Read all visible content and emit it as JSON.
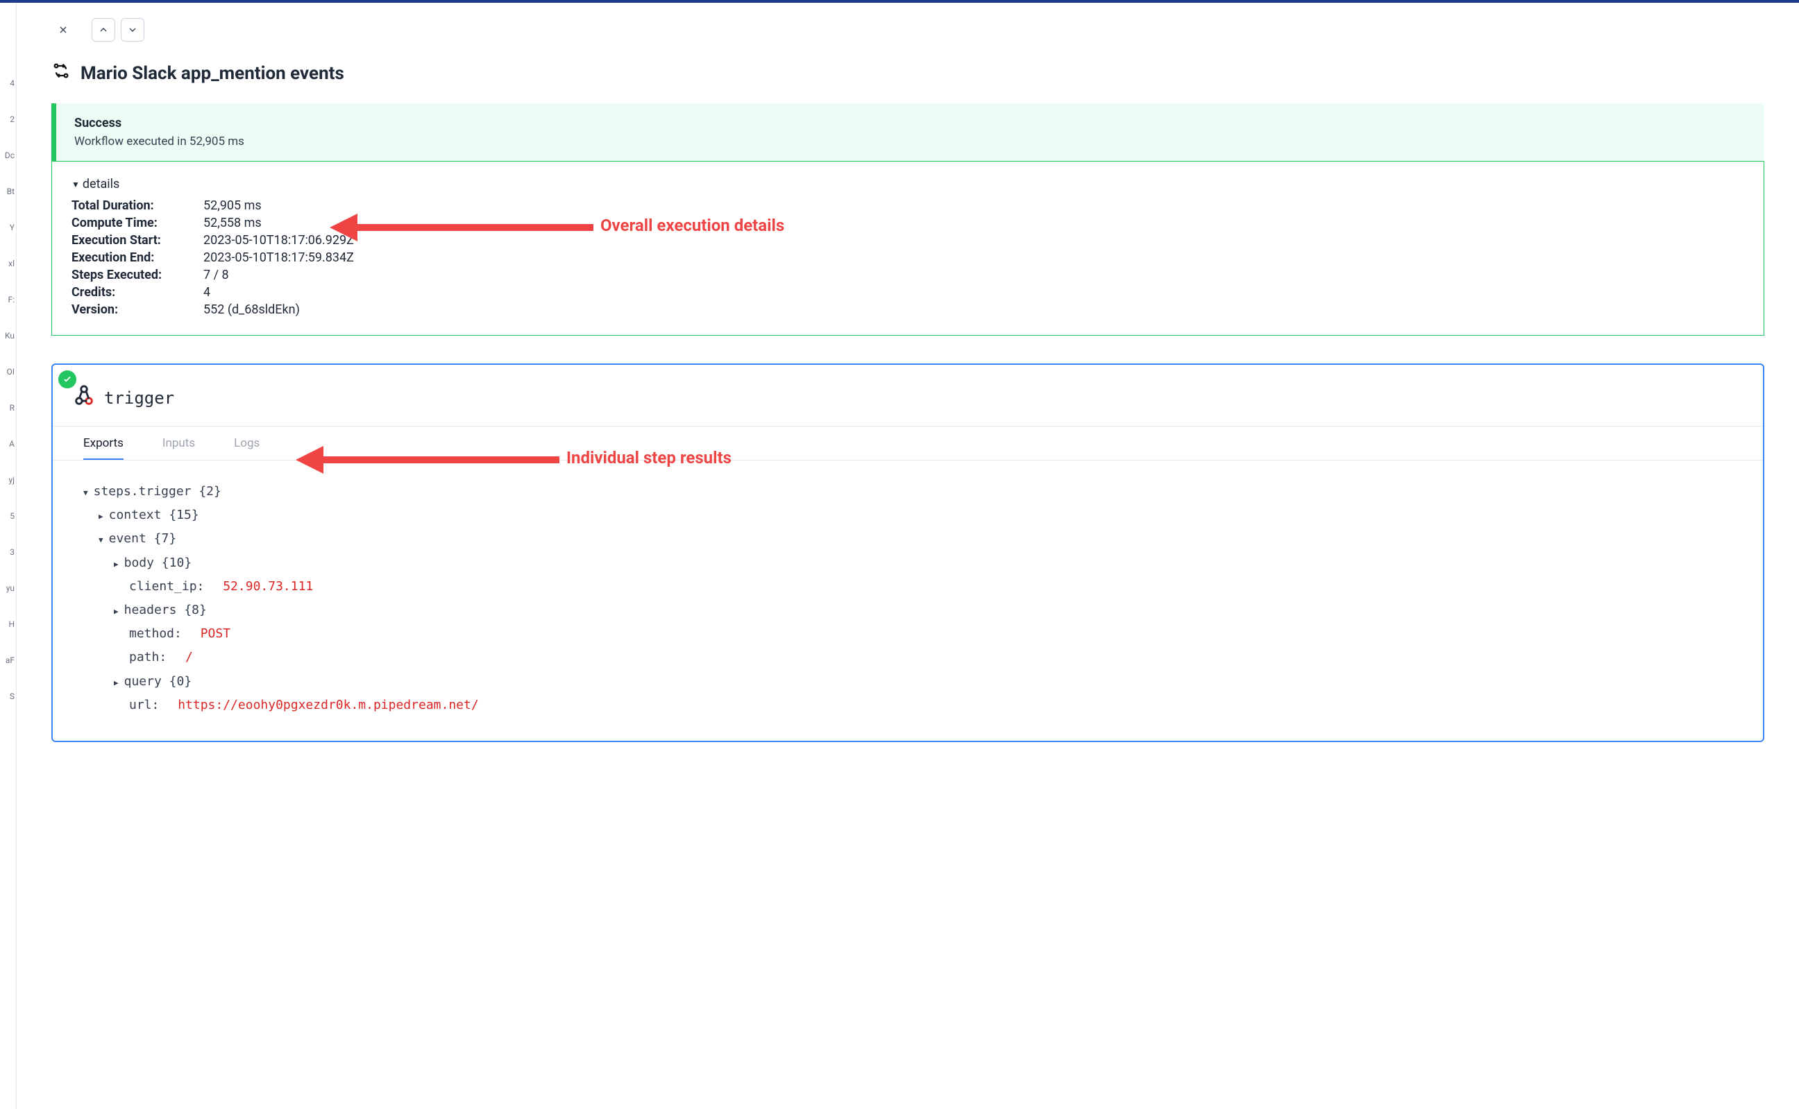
{
  "leftStrip": [
    "4",
    "2",
    "Dc",
    "Bt",
    "Y",
    "xl",
    "F:",
    "Ku",
    "OI",
    "R",
    "A",
    "yj",
    "5",
    "3",
    "yu",
    "H",
    "aF",
    "S"
  ],
  "workflow": {
    "title": "Mario Slack app_mention events"
  },
  "success": {
    "label": "Success",
    "subtext": "Workflow executed in 52,905 ms"
  },
  "details": {
    "toggleLabel": "details",
    "rows": [
      {
        "k": "Total Duration:",
        "v": "52,905 ms"
      },
      {
        "k": "Compute Time:",
        "v": "52,558 ms"
      },
      {
        "k": "Execution Start:",
        "v": "2023-05-10T18:17:06.929Z"
      },
      {
        "k": "Execution End:",
        "v": "2023-05-10T18:17:59.834Z"
      },
      {
        "k": "Steps Executed:",
        "v": "7 / 8"
      },
      {
        "k": "Credits:",
        "v": "4"
      },
      {
        "k": "Version:",
        "v": "552 (d_68sldEkn)"
      }
    ]
  },
  "trigger": {
    "title": "trigger",
    "tabs": {
      "exports": "Exports",
      "inputs": "Inputs",
      "logs": "Logs",
      "active": "exports"
    },
    "tree": {
      "root": "steps.trigger {2}",
      "context": "context {15}",
      "event": "event {7}",
      "body": "body {10}",
      "clientIpK": "client_ip:",
      "clientIpV": "52.90.73.111",
      "headers": "headers {8}",
      "methodK": "method:",
      "methodV": "POST",
      "pathK": "path:",
      "pathV": "/",
      "query": "query {0}",
      "urlK": "url:",
      "urlV": "https://eoohy0pgxezdr0k.m.pipedream.net/"
    }
  },
  "annotations": {
    "overall": "Overall execution details",
    "steps": "Individual step results"
  }
}
